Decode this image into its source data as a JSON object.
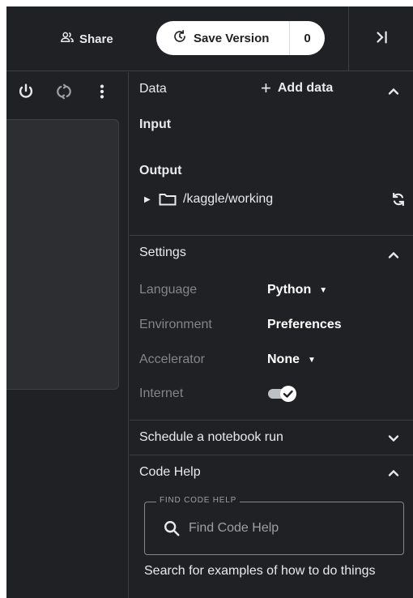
{
  "topbar": {
    "share_label": "Share",
    "save_version_label": "Save Version",
    "save_version_count": "0"
  },
  "left_toolbar": {
    "icons": [
      "power-icon",
      "sync-icon",
      "more-vert-icon"
    ]
  },
  "data_panel": {
    "title": "Data",
    "add_data_label": "Add data",
    "input_label": "Input",
    "output_label": "Output",
    "output_path": "/kaggle/working"
  },
  "settings": {
    "title": "Settings",
    "language_label": "Language",
    "language_value": "Python",
    "environment_label": "Environment",
    "environment_value": "Preferences",
    "accelerator_label": "Accelerator",
    "accelerator_value": "None",
    "internet_label": "Internet",
    "internet_enabled": true
  },
  "schedule": {
    "title": "Schedule a notebook run"
  },
  "code_help": {
    "title": "Code Help",
    "field_legend": "FIND CODE HELP",
    "search_placeholder": "Find Code Help",
    "helper_text": "Search for examples of how to do things"
  },
  "colors": {
    "background": "#202124",
    "border": "#3c4043",
    "muted_text": "#80868b",
    "toggle_on": "#bdc1c6"
  }
}
